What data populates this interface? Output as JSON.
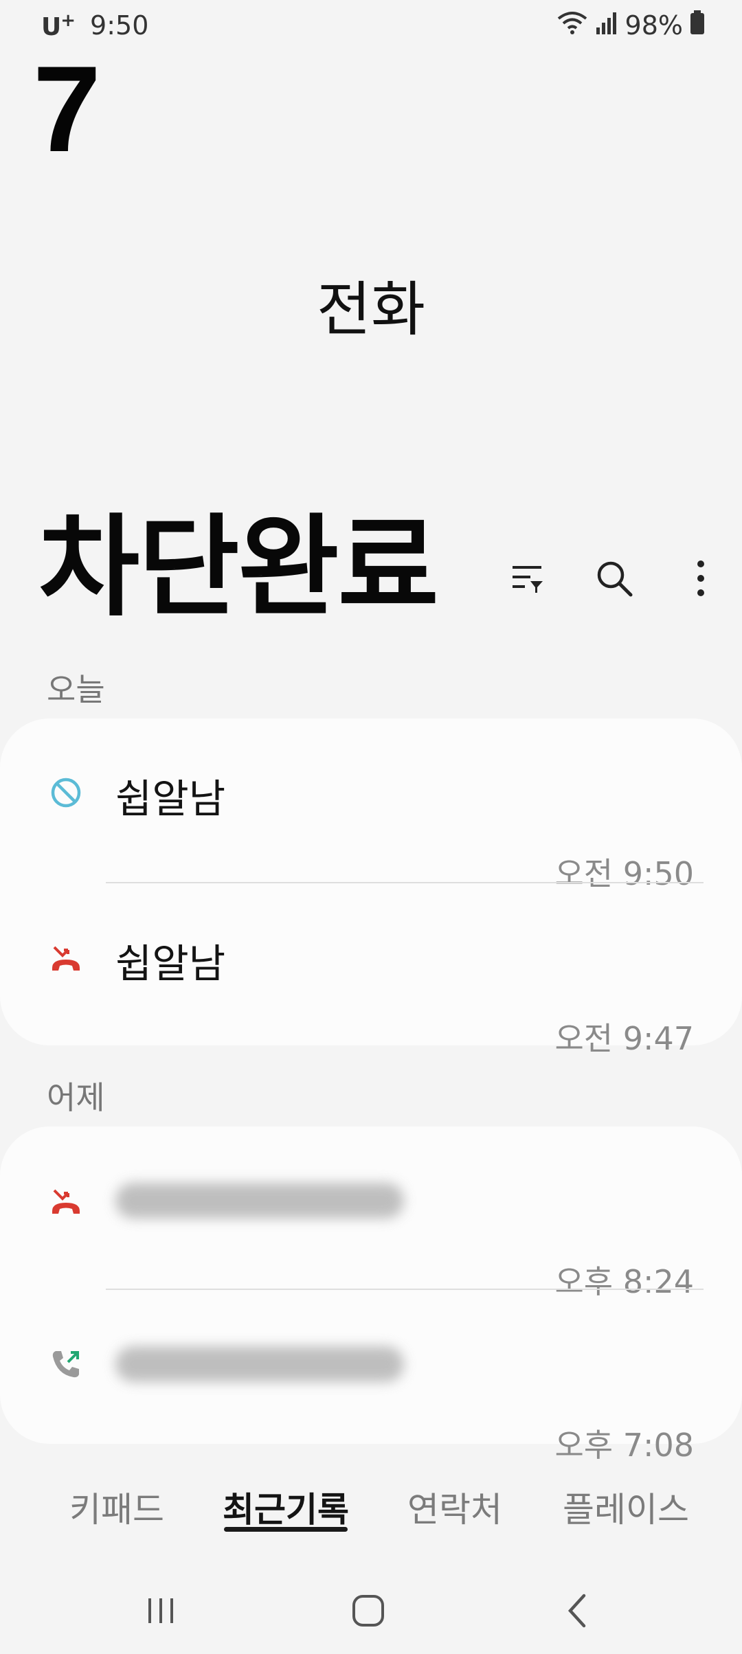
{
  "status_bar": {
    "carrier": "U",
    "carrier_mark": "+",
    "time": "9:50",
    "battery": "98%",
    "icons": [
      "wifi-icon",
      "signal-icon",
      "battery-icon"
    ]
  },
  "overlay": {
    "number": "7",
    "text": "차단완료"
  },
  "app": {
    "title": "전화"
  },
  "toolbar": {
    "icons": [
      "filter-icon",
      "search-icon",
      "more-options-icon"
    ]
  },
  "sections": [
    {
      "label": "오늘",
      "calls": [
        {
          "name": "쉽알남",
          "time": "오전 9:50",
          "type": "blocked",
          "icon": "blocked-call-icon"
        },
        {
          "name": "쉽알남",
          "time": "오전 9:47",
          "type": "missed",
          "icon": "missed-call-icon"
        }
      ]
    },
    {
      "label": "어제",
      "calls": [
        {
          "name": "",
          "time": "오후 8:24",
          "type": "missed",
          "icon": "missed-call-icon"
        },
        {
          "name": "",
          "time": "오후 7:08",
          "type": "outgoing",
          "icon": "outgoing-call-icon"
        }
      ]
    }
  ],
  "tabs": [
    {
      "label": "키패드",
      "active": false
    },
    {
      "label": "최근기록",
      "active": true
    },
    {
      "label": "연락처",
      "active": false
    },
    {
      "label": "플레이스",
      "active": false
    }
  ],
  "navigation": {
    "icons": [
      "recent-apps-icon",
      "home-icon",
      "back-icon"
    ]
  },
  "colors": {
    "background": "#f4f4f4",
    "card": "#fcfcfc",
    "blocked": "#5bbbd6",
    "missed": "#d93a30",
    "outgoing_arrow": "#22a772",
    "phone_gray": "#9a9a9a"
  }
}
